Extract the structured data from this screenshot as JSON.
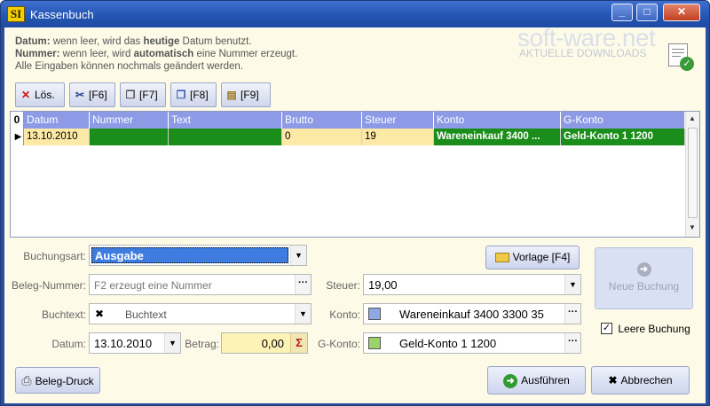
{
  "window": {
    "title": "Kassenbuch",
    "app_icon_text": "SI",
    "minimize": "_",
    "maximize": "□",
    "close": "✕"
  },
  "info": {
    "line1_label": "Datum:",
    "line1_text": " wenn leer, wird das ",
    "line1_bold": "heutige",
    "line1_end": " Datum benutzt.",
    "line2_label": "Nummer:",
    "line2_text": " wenn leer, wird ",
    "line2_bold": "automatisch",
    "line2_end": " eine Nummer erzeugt.",
    "line3": "Alle Eingaben können nochmals geändert werden."
  },
  "brand": {
    "main": "soft-ware.net",
    "sub": "AKTUELLE DOWNLOADS"
  },
  "toolbar": {
    "delete_label": "Lös.",
    "cut_label": "[F6]",
    "copy_label": "[F7]",
    "copy2_label": "[F8]",
    "paste_label": "[F9]"
  },
  "grid": {
    "row_header": "0",
    "columns": [
      "Datum",
      "Nummer",
      "Text",
      "Brutto",
      "Steuer",
      "Konto",
      "G-Konto"
    ],
    "rows": [
      {
        "marker": "▶",
        "datum": "13.10.2010",
        "nummer": "",
        "text": "",
        "brutto": "0",
        "steuer": "19",
        "konto": "Wareneinkauf  3400 ...",
        "gkonto": "Geld-Konto 1  1200"
      }
    ]
  },
  "form": {
    "buchungsart_label": "Buchungsart:",
    "buchungsart_value": "Ausgabe",
    "beleg_label": "Beleg-Nummer:",
    "beleg_placeholder": "F2 erzeugt eine Nummer",
    "buchtext_label": "Buchtext:",
    "buchtext_value": "Buchtext",
    "datum_label": "Datum:",
    "datum_value": "13.10.2010",
    "betrag_label": "Betrag:",
    "betrag_value": "0,00",
    "steuer_label": "Steuer:",
    "steuer_value": "19,00",
    "konto_label": "Konto:",
    "konto_value": "Wareneinkauf  3400 3300 35",
    "konto_color": "#8fa8e4",
    "gkonto_label": "G-Konto:",
    "gkonto_value": "Geld-Konto 1  1200",
    "gkonto_color": "#9bd36a"
  },
  "buttons": {
    "vorlage": "Vorlage [F4]",
    "neue_buchung": "Neue Buchung",
    "leere_buchung": "Leere Buchung",
    "beleg_druck": "Beleg-Druck",
    "ausfuehren": "Ausführen",
    "abbrechen": "Abbrechen"
  }
}
